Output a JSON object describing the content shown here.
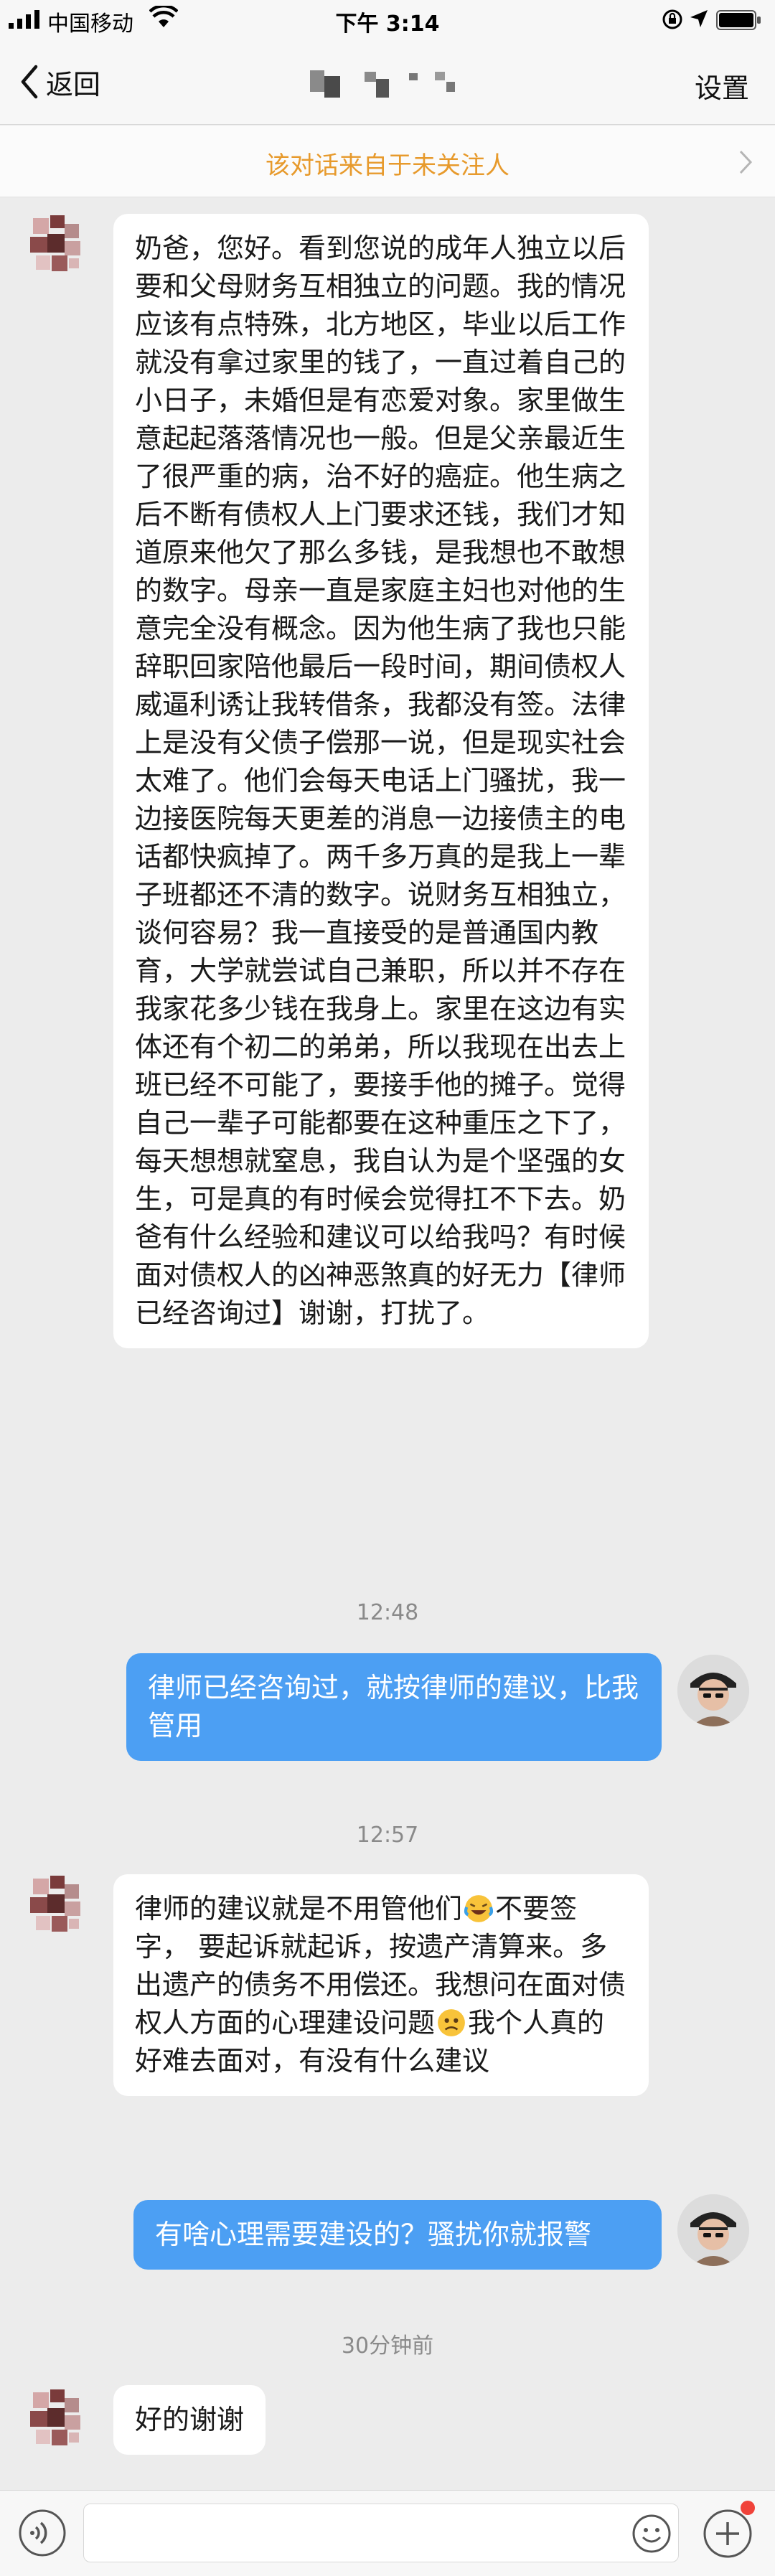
{
  "status_bar": {
    "carrier": "中国移动",
    "time": "下午 3:14"
  },
  "nav": {
    "back_label": "返回",
    "settings_label": "设置"
  },
  "notice": {
    "text": "该对话来自于未关注人"
  },
  "messages": [
    {
      "direction": "in",
      "text": "奶爸，您好。看到您说的成年人独立以后要和父母财务互相独立的问题。我的情况应该有点特殊，北方地区，毕业以后工作就没有拿过家里的钱了，一直过着自己的小日子，未婚但是有恋爱对象。家里做生意起起落落情况也一般。但是父亲最近生了很严重的病，治不好的癌症。他生病之后不断有债权人上门要求还钱，我们才知道原来他欠了那么多钱，是我想也不敢想的数字。母亲一直是家庭主妇也对他的生意完全没有概念。因为他生病了我也只能辞职回家陪他最后一段时间，期间债权人威逼利诱让我转借条，我都没有签。法律上是没有父债子偿那一说，但是现实社会太难了。他们会每天电话上门骚扰，我一边接医院每天更差的消息一边接债主的电话都快疯掉了。两千多万真的是我上一辈子班都还不清的数字。说财务互相独立，谈何容易？我一直接受的是普通国内教育，大学就尝试自己兼职，所以并不存在我家花多少钱在我身上。家里在这边有实体还有个初二的弟弟，所以我现在出去上班已经不可能了，要接手他的摊子。觉得自己一辈子可能都要在这种重压之下了，每天想想就窒息，我自认为是个坚强的女生，可是真的有时候会觉得扛不下去。奶爸有什么经验和建议可以给我吗？有时候面对债权人的凶神恶煞真的好无力【律师已经咨询过】谢谢，打扰了。"
    },
    {
      "direction": "time",
      "text": "12:48"
    },
    {
      "direction": "out",
      "text": "律师已经咨询过，就按律师的建议，比我管用"
    },
    {
      "direction": "time",
      "text": "12:57"
    },
    {
      "direction": "in",
      "text_part1": "律师的建议就是不用管他们",
      "text_part2": "不要签字，  要起诉就起诉，按遗产清算来。多出遗产的债务不用偿还。我想问在面对债权人方面的心理建设问题",
      "text_part3": "我个人真的好难去面对，有没有什么建议"
    },
    {
      "direction": "out",
      "text": "有啥心理需要建设的？骚扰你就报警"
    },
    {
      "direction": "time",
      "text": "30分钟前"
    },
    {
      "direction": "in",
      "text": "好的谢谢"
    }
  ],
  "icons": {
    "laugh_cry": "laughing-crying-emoji",
    "worried": "worried-face-emoji"
  },
  "colors": {
    "outgoing_bubble": "#4c9ff3",
    "notice_text": "#e79a2c",
    "background": "#ececec"
  }
}
